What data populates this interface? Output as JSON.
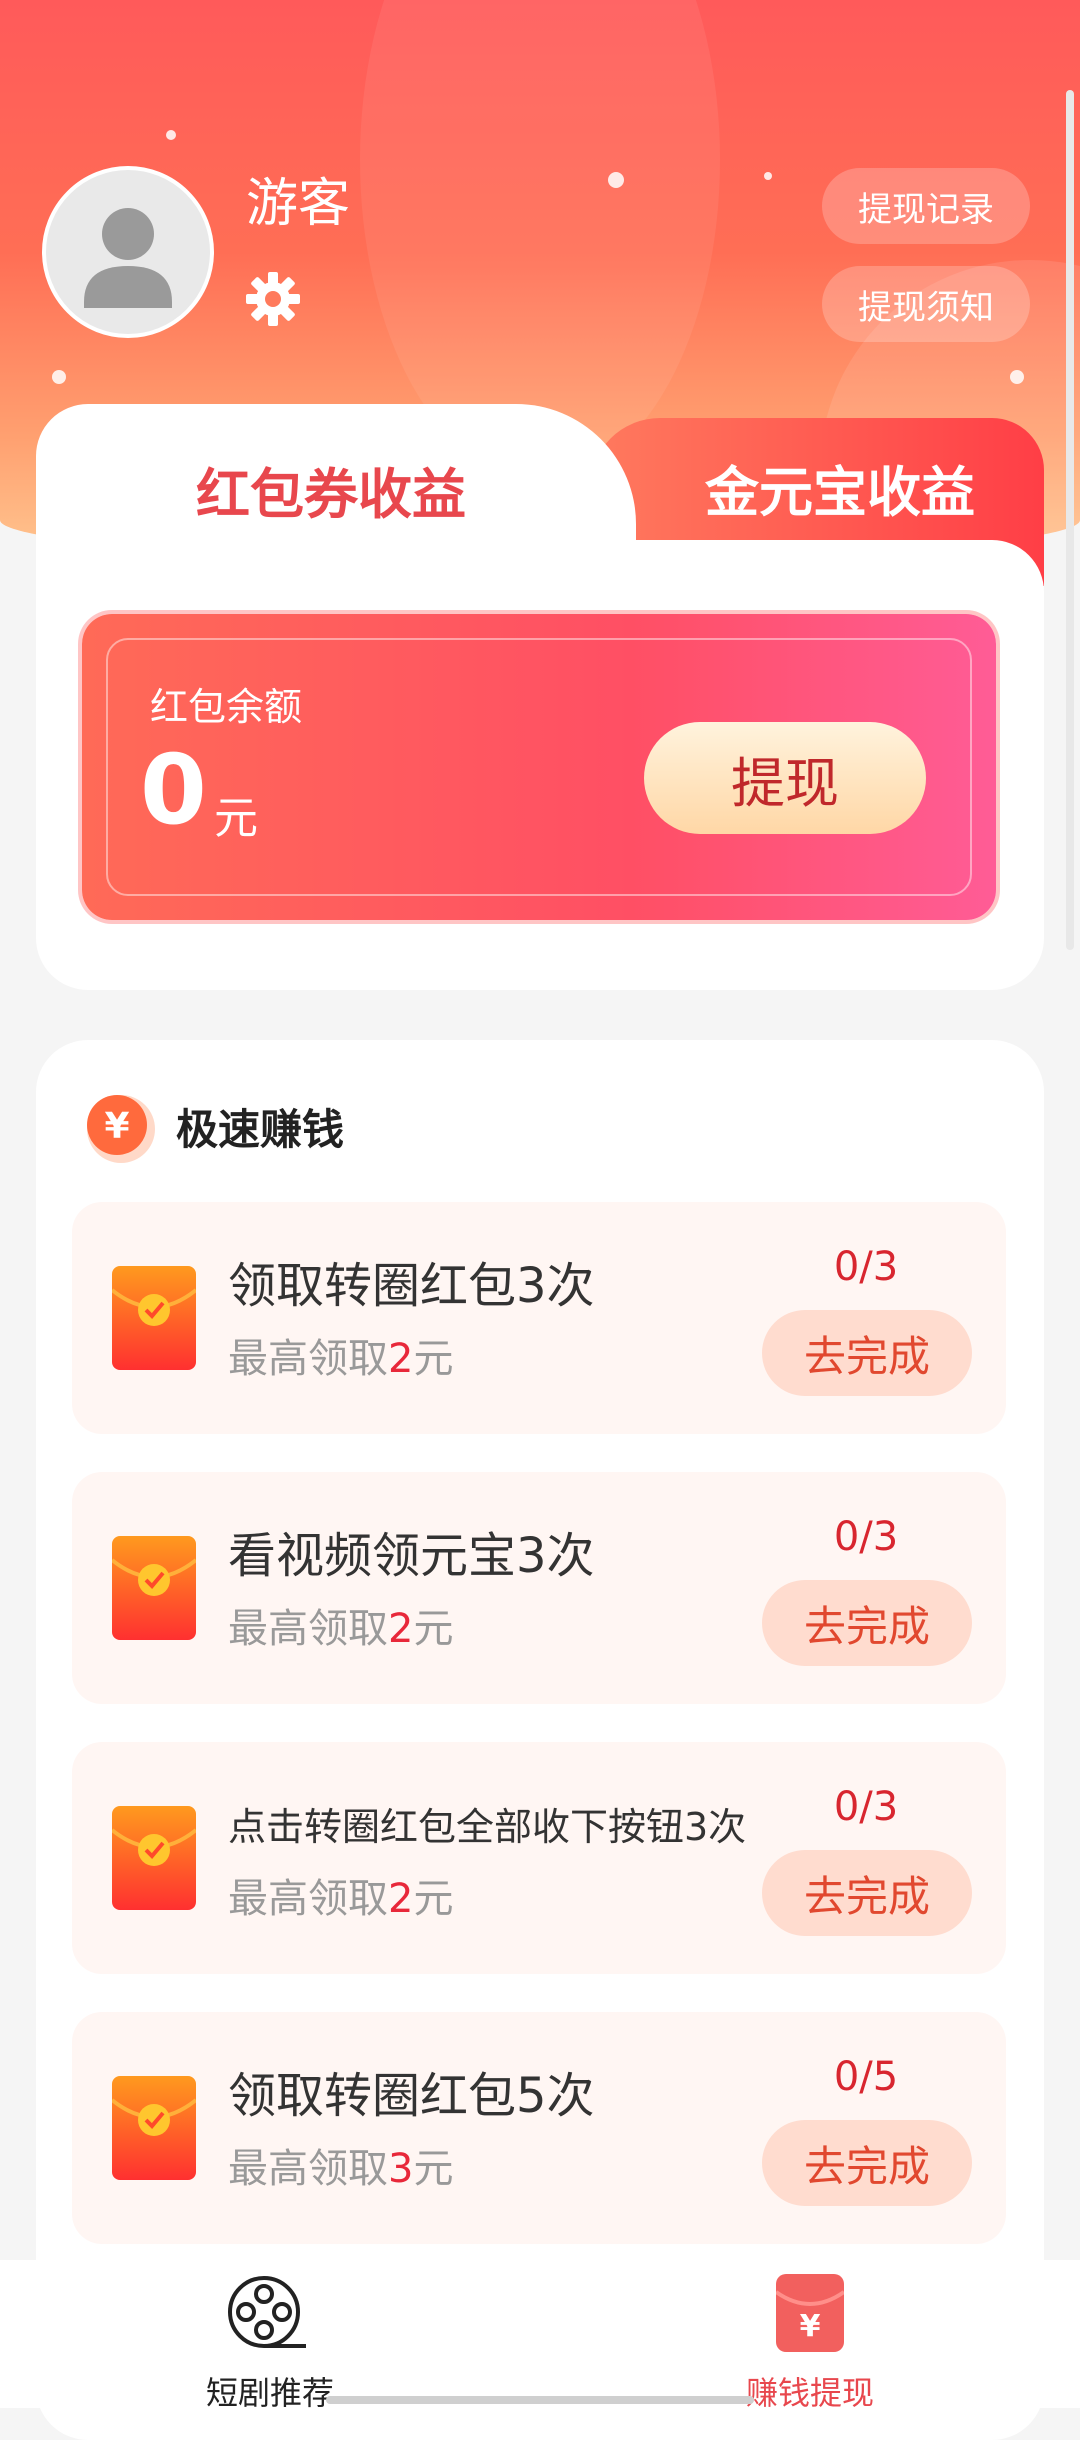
{
  "profile": {
    "username": "游客"
  },
  "header_buttons": {
    "withdraw_record": "提现记录",
    "withdraw_notice": "提现须知"
  },
  "tabs": [
    {
      "label": "红包券收益",
      "active": true
    },
    {
      "label": "金元宝收益",
      "active": false
    }
  ],
  "balance": {
    "label": "红包余额",
    "amount": "0",
    "unit": "元",
    "withdraw_label": "提现"
  },
  "section": {
    "title": "极速赚钱",
    "icon": "yuan-coin-icon"
  },
  "tasks": [
    {
      "title": "领取转圈红包3次",
      "sub_prefix": "最高领取",
      "sub_amount": "2",
      "sub_suffix": "元",
      "progress": "0/3",
      "button": "去完成"
    },
    {
      "title": "看视频领元宝3次",
      "sub_prefix": "最高领取",
      "sub_amount": "2",
      "sub_suffix": "元",
      "progress": "0/3",
      "button": "去完成"
    },
    {
      "title": "点击转圈红包全部收下按钮3次",
      "sub_prefix": "最高领取",
      "sub_amount": "2",
      "sub_suffix": "元",
      "progress": "0/3",
      "button": "去完成"
    },
    {
      "title": "领取转圈红包5次",
      "sub_prefix": "最高领取",
      "sub_amount": "3",
      "sub_suffix": "元",
      "progress": "0/5",
      "button": "去完成"
    }
  ],
  "bottom_nav": [
    {
      "label": "短剧推荐",
      "icon": "film-reel-icon",
      "active": false
    },
    {
      "label": "赚钱提现",
      "icon": "red-envelope-icon",
      "active": true
    }
  ],
  "colors": {
    "accent": "#e8474d",
    "active_nav": "#e8474d",
    "inactive_nav": "#222222"
  }
}
